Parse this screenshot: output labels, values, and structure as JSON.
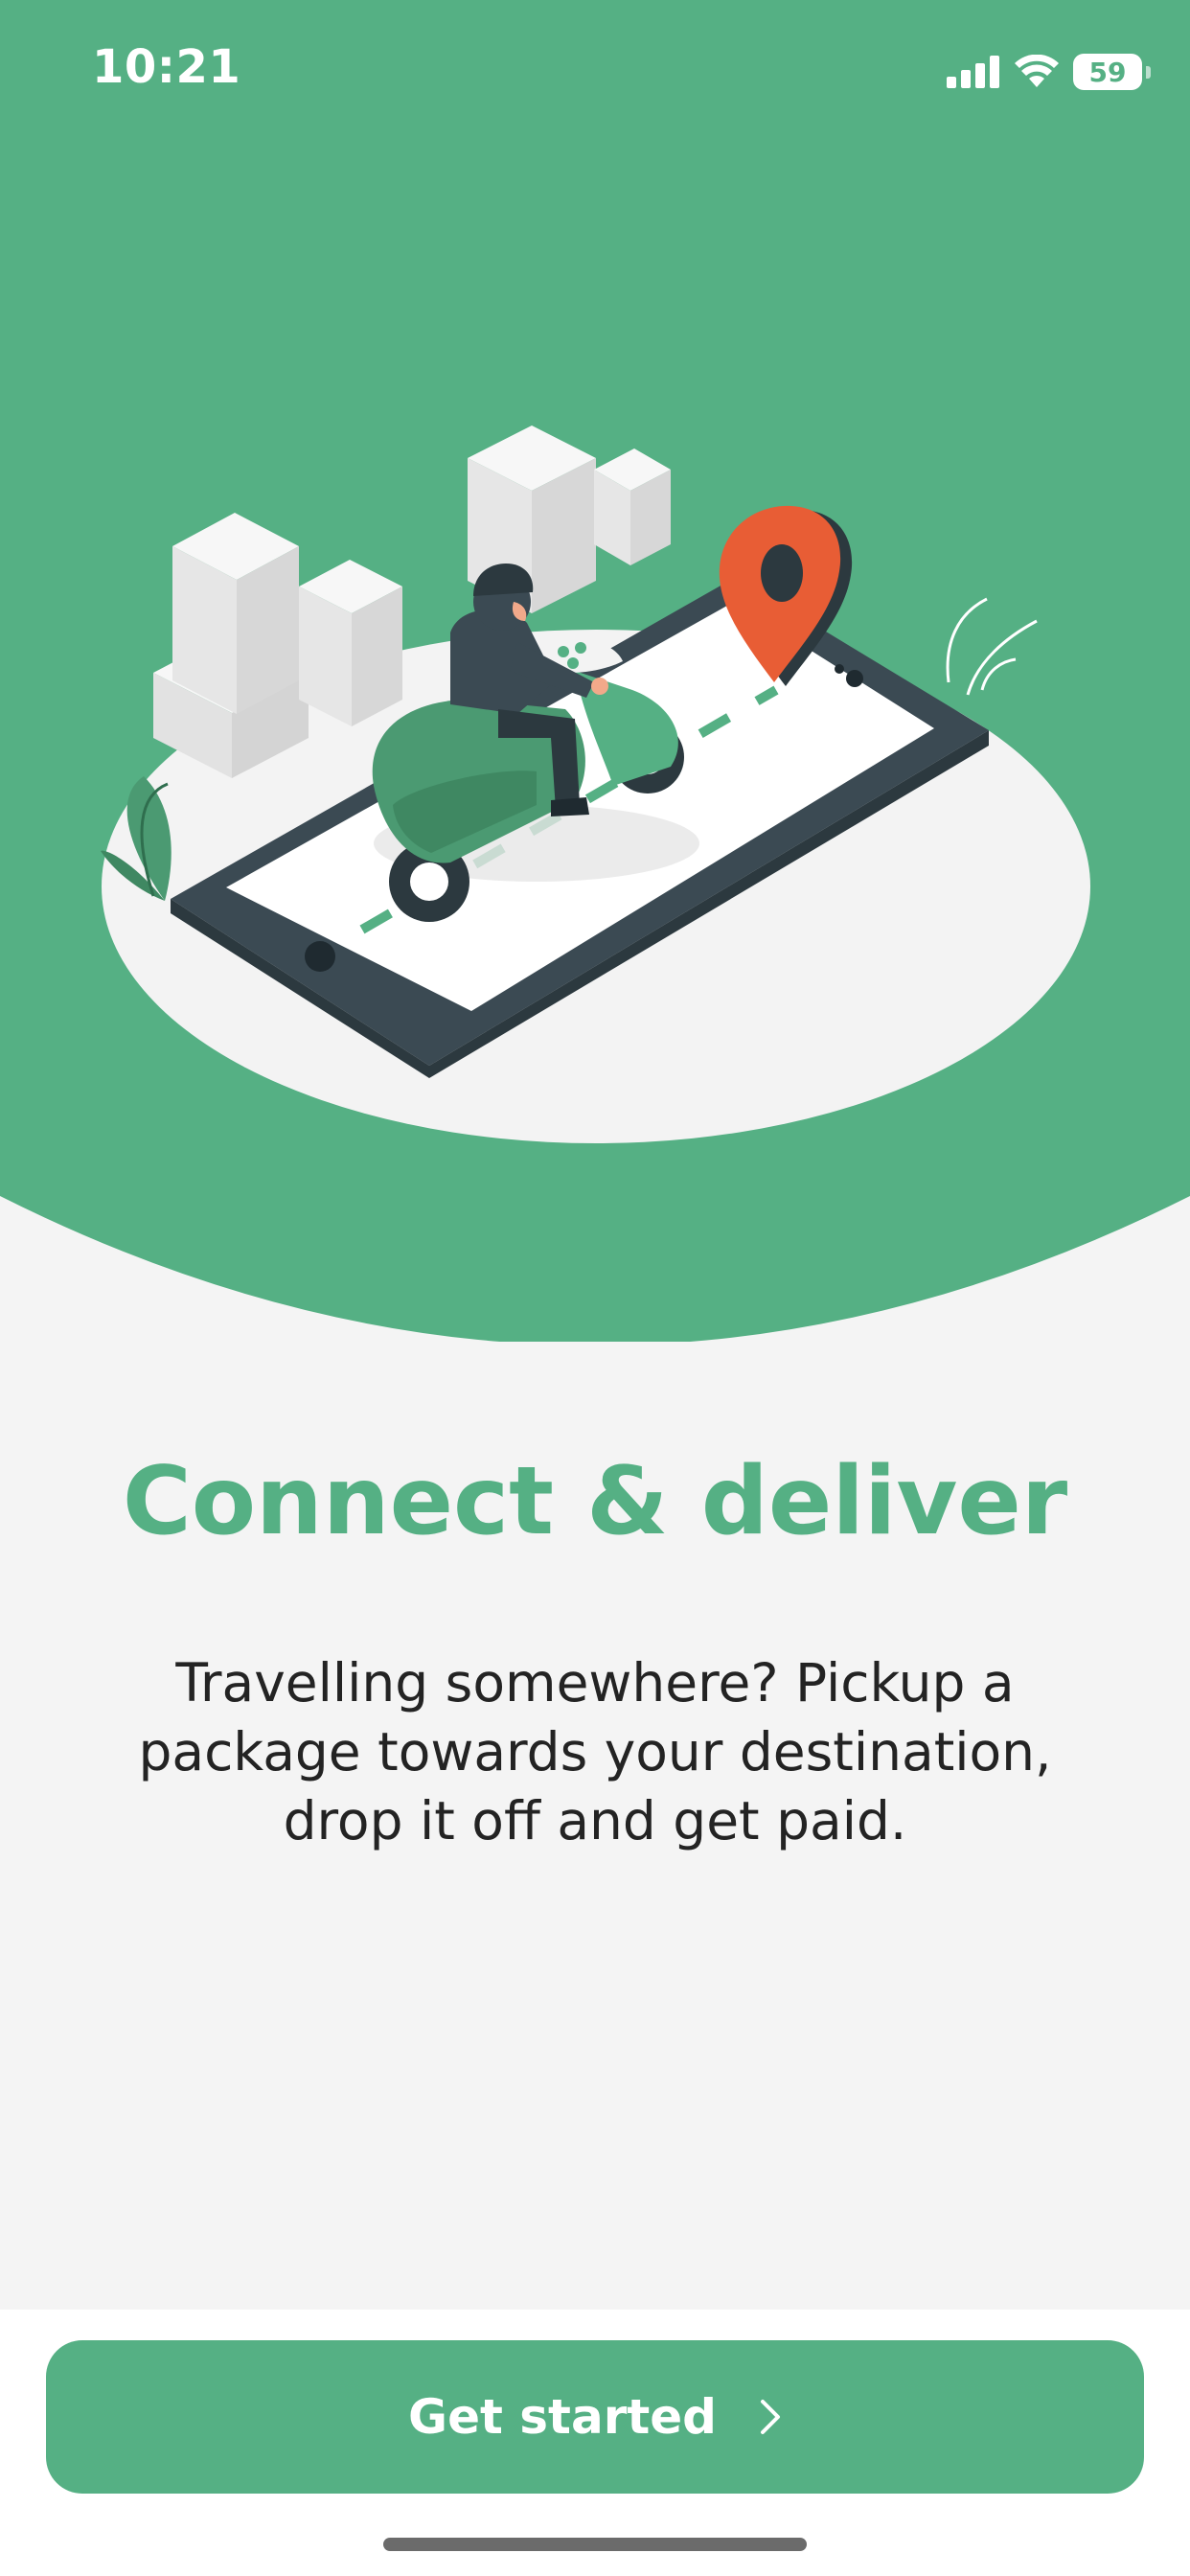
{
  "status_bar": {
    "time": "10:21",
    "battery_level": "59",
    "icons": [
      "signal-icon",
      "wifi-icon",
      "battery-icon"
    ]
  },
  "onboarding": {
    "title": "Connect & deliver",
    "description": "Travelling somewhere? Pickup a package towards your destination, drop it off and get paid.",
    "cta_label": "Get started",
    "cta_icon": "chevron-right-icon"
  },
  "illustration": {
    "subject": "courier-on-scooter-phone-map-illustration"
  },
  "colors": {
    "brand_green": "#55b084",
    "background": "#f4f4f4",
    "text_dark": "#232323",
    "pin_orange": "#e85d35"
  }
}
